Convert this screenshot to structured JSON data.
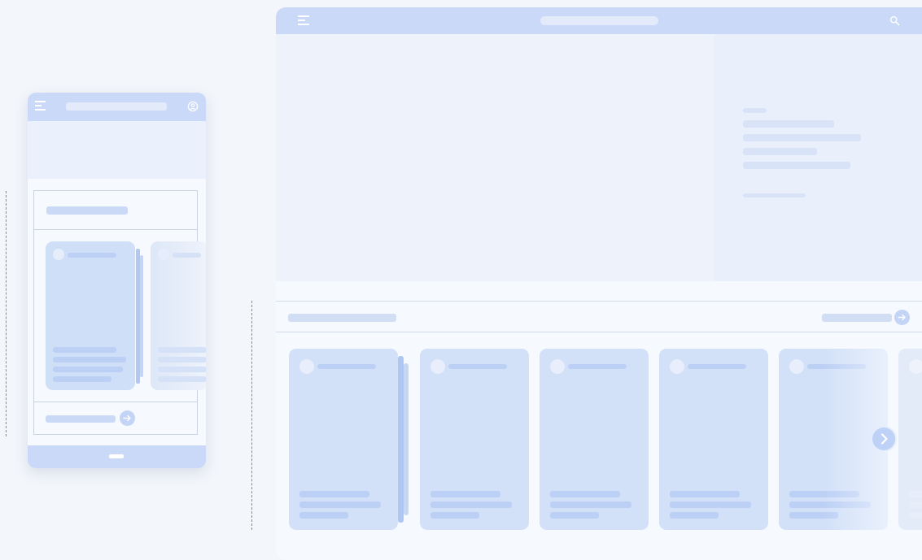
{
  "colors": {
    "page_background": "#f3f6fa",
    "header": "#cad9f8",
    "placeholder": "#bcd0f5",
    "tile": "#d2e0f8",
    "guide_line": "#7a84c8"
  },
  "mobile": {
    "header_icons": [
      "menu-icon",
      "account-icon"
    ],
    "tiles_visible": 2,
    "footer_icon": "home-indicator-icon",
    "footer_action_icon": "arrow-right-icon"
  },
  "desktop": {
    "header_icons": [
      "menu-icon",
      "search-icon"
    ],
    "cards_visible": 6,
    "section_action_icon": "arrow-right-icon",
    "carousel_control_icon": "chevron-right-icon"
  }
}
